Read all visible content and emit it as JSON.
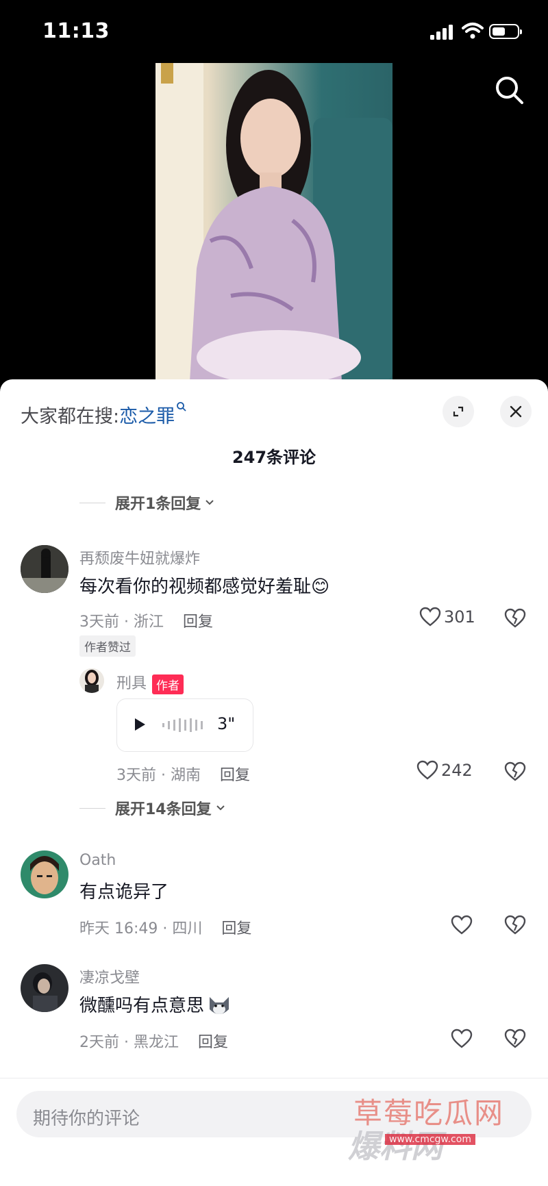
{
  "status_bar": {
    "time": "11:13"
  },
  "hot_search": {
    "prefix": "大家都在搜:",
    "keyword": "恋之罪"
  },
  "comments_count": "247条评论",
  "expand_top": "展开1条回复",
  "comments": [
    {
      "username": "再颓废牛妞就爆炸",
      "text": "每次看你的视频都感觉好羞耻😊",
      "meta": "3天前 · 浙江",
      "reply": "回复",
      "likes": "301",
      "badge": "作者赞过"
    },
    {
      "username": "Oath",
      "text": "有点诡异了",
      "meta": "昨天 16:49 · 四川",
      "reply": "回复",
      "likes": ""
    },
    {
      "username": "凄凉戈壁",
      "text": "微醺吗有点意思",
      "meta": "2天前 · 黑龙江",
      "reply": "回复",
      "likes": ""
    }
  ],
  "author_reply": {
    "username": "刑具",
    "tag": "作者",
    "voice_duration": "3\"",
    "meta": "3天前 · 湖南",
    "reply": "回复",
    "likes": "242"
  },
  "expand_replies": "展开14条回复",
  "input": {
    "placeholder": "期待你的评论"
  },
  "watermark": {
    "line1": "草莓吃瓜网",
    "line2": "爆料网",
    "url": "www.cmcgw.com"
  },
  "colors": {
    "accent_red": "#fe2c55",
    "link_blue": "#1a5aa8"
  }
}
